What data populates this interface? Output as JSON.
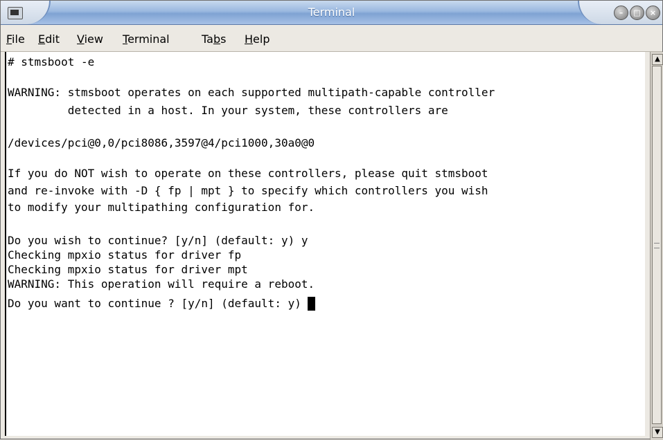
{
  "window": {
    "title": "Terminal"
  },
  "titlebar": {
    "minimize_symbol": "–",
    "maximize_symbol": "□",
    "close_symbol": "×"
  },
  "menu": {
    "file": {
      "pre": "",
      "key": "F",
      "post": "ile"
    },
    "edit": {
      "pre": "",
      "key": "E",
      "post": "dit"
    },
    "view": {
      "pre": "",
      "key": "V",
      "post": "iew"
    },
    "terminal": {
      "pre": "",
      "key": "T",
      "post": "erminal"
    },
    "tabs": {
      "pre": "Ta",
      "key": "b",
      "post": "s"
    },
    "help": {
      "pre": "",
      "key": "H",
      "post": "elp"
    }
  },
  "terminal": {
    "lines": [
      "# stmsboot -e",
      "",
      "WARNING: stmsboot operates on each supported multipath-capable controller",
      "         detected in a host. In your system, these controllers are",
      "",
      "/devices/pci@0,0/pci8086,3597@4/pci1000,30a0@0",
      "",
      "If you do NOT wish to operate on these controllers, please quit stmsboot",
      "and re-invoke with -D { fp | mpt } to specify which controllers you wish",
      "to modify your multipathing configuration for.",
      "",
      "Do you wish to continue? [y/n] (default: y) y",
      "Checking mpxio status for driver fp",
      "Checking mpxio status for driver mpt",
      "WARNING: This operation will require a reboot.",
      "Do you want to continue ? [y/n] (default: y) "
    ]
  },
  "scrollbar": {
    "up_arrow": "▲",
    "down_arrow": "▼",
    "position_fraction": 0.0
  }
}
